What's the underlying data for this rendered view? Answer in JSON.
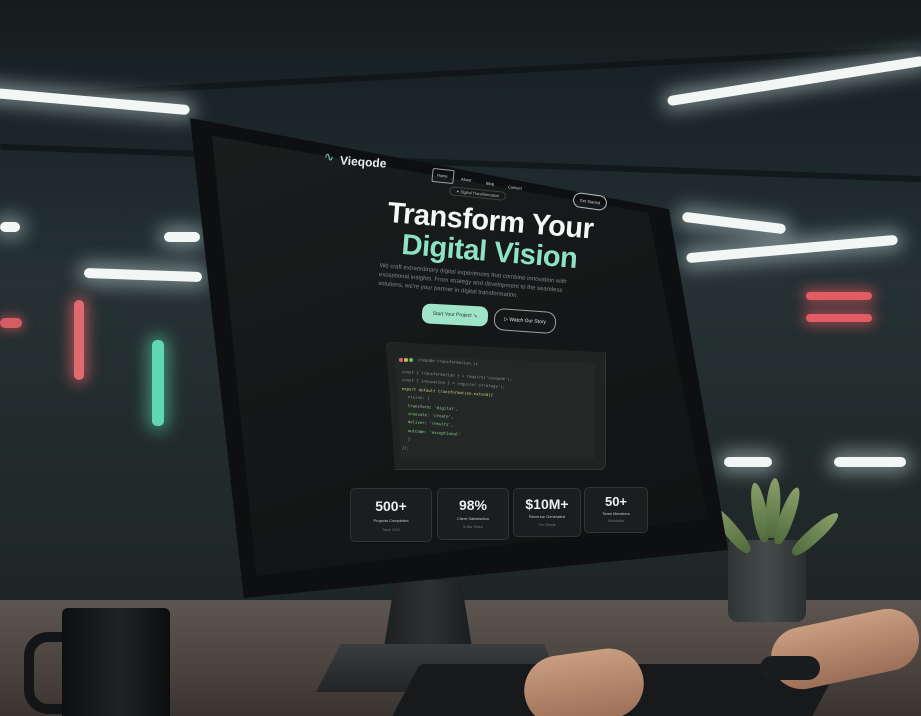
{
  "nav": {
    "logo": "Vieqode",
    "links": [
      "Home",
      "About",
      "Blog",
      "Contact"
    ],
    "cta": "Get Started"
  },
  "hero": {
    "badge": "✦ Digital Transformation",
    "title_line1": "Transform Your",
    "title_line2": "Digital Vision",
    "description": "We craft extraordinary digital experiences that combine innovation with exceptional insights. From strategy and development to the seamless solutions, we're your partner in digital transformation.",
    "primary_button": "Start Your Project",
    "primary_arrow": "↘",
    "secondary_icon": "▷",
    "secondary_button": "Watch Our Story"
  },
  "code": {
    "title": "vieqode-transformation.js",
    "dots": [
      "#e0675b",
      "#e0b24f",
      "#60c06b"
    ],
    "lines": [
      "const { transformation } = require('vieqode');",
      "const { innovation } = require('strategy');",
      "export default transformation.extend({",
      "  vision: {",
      "    transform: 'digital',",
      "    innovate: 'create',",
      "    deliver: 'results',",
      "    outcome: 'exceptional'",
      "  }",
      "});"
    ]
  },
  "stats": [
    {
      "value": "500+",
      "label": "Projects Completed",
      "sub": "Since 2015"
    },
    {
      "value": "98%",
      "label": "Client Satisfaction",
      "sub": "5-Star Rated"
    },
    {
      "value": "$10M+",
      "label": "Revenue Generated",
      "sub": "For Clients"
    },
    {
      "value": "50+",
      "label": "Team Members",
      "sub": "Worldwide"
    }
  ],
  "colors": {
    "accent": "#8de2c5",
    "screen_bg": "#141617",
    "primary_button": "#9fe3c8"
  }
}
